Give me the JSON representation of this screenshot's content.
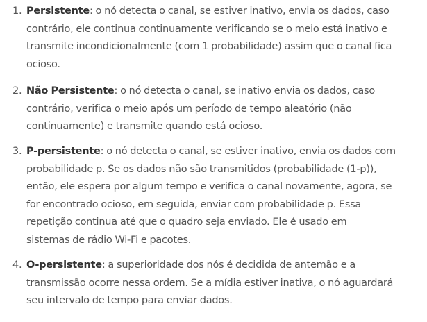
{
  "items": [
    {
      "number": "1.",
      "term": "Persistente",
      "lines": [
        ": o nó detecta o canal, se estiver inativo, envia os dados, caso",
        "contrário, ele continua continuamente verificando se o meio está inativo e",
        "transmite incondicionalmente (com 1 probabilidade) assim que o canal fica",
        "ocioso."
      ]
    },
    {
      "number": "2.",
      "term": "Não Persistente",
      "lines": [
        ": o nó detecta o canal, se inativo envia os dados, caso",
        "contrário, verifica o meio após um período de tempo aleatório (não",
        "continuamente) e transmite quando está ocioso."
      ]
    },
    {
      "number": "3.",
      "term": "P-persistente",
      "lines": [
        ": o nó detecta o canal, se estiver inativo, envia os dados com",
        "probabilidade p. Se os dados não são transmitidos (probabilidade (1-p)),",
        "então, ele espera por algum tempo e verifica o canal novamente, agora, se",
        "for encontrado ocioso, em seguida, enviar com probabilidade p. Essa",
        "repetição continua até que o quadro seja enviado. Ele é usado em",
        "sistemas de rádio Wi-Fi e pacotes."
      ]
    },
    {
      "number": "4.",
      "term": "O-persistente",
      "lines": [
        ": a superioridade dos nós é decidida de antemão e a",
        "transmissão ocorre nessa ordem. Se a mídia estiver inativa, o nó aguardará",
        "seu intervalo de tempo para enviar dados."
      ]
    }
  ]
}
